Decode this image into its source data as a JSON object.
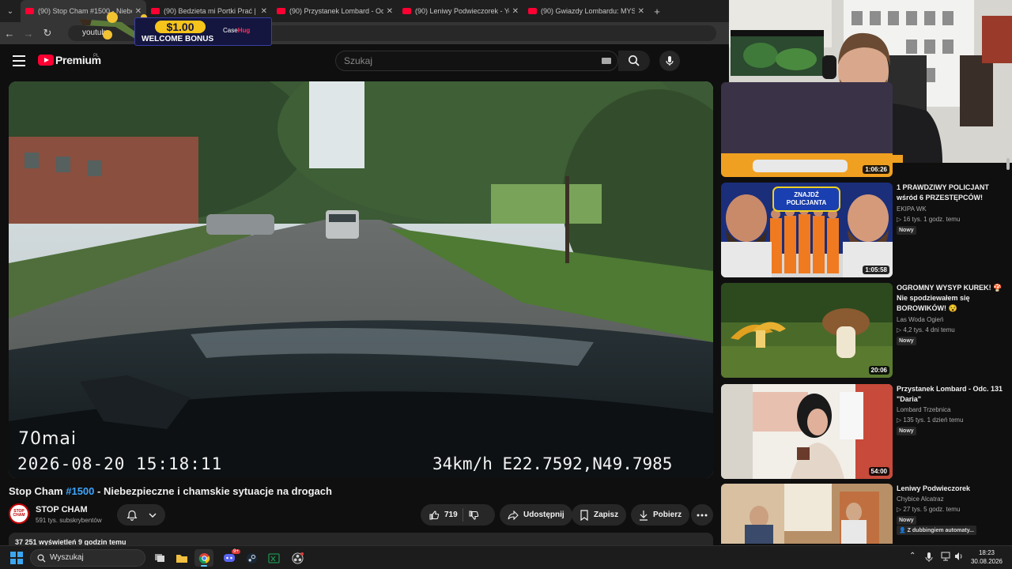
{
  "browser": {
    "tabs": [
      {
        "title": "(90) Stop Cham #1500 - Niebe",
        "active": true
      },
      {
        "title": "(90) Bedzieta mi Portki Prać | Sz",
        "active": false
      },
      {
        "title": "(90) Przystanek Lombard - Odc",
        "active": false
      },
      {
        "title": "(90) Leniwy Podwieczorek - You",
        "active": false
      },
      {
        "title": "(90) Gwiazdy Lombardu: MYSTE",
        "active": false
      }
    ],
    "new_tab_label": "+",
    "url": "youtube"
  },
  "ad": {
    "amount": "$1.00",
    "text": "WELCOME BONUS",
    "brand_a": "Case",
    "brand_b": "Hug"
  },
  "youtube": {
    "logo": "Premium",
    "country_code": "PL",
    "search_placeholder": "Szukaj"
  },
  "player": {
    "osd_brand": "70mai",
    "osd_datetime": "2026-08-20 15:18:11",
    "osd_gps": "34km/h E22.7592,N49.7985"
  },
  "video": {
    "title_prefix": "Stop Cham ",
    "title_tag": "#1500",
    "title_suffix": " - Niebezpieczne i chamskie sytuacje na drogach",
    "channel": "STOP CHAM",
    "channel_avatar_text": "STOP CHAM",
    "subscribers": "591 tys. subskrybentów",
    "likes": "719",
    "share": "Udostępnij",
    "save": "Zapisz",
    "download": "Pobierz",
    "views": "37 251 wyświetleń  9 godzin temu"
  },
  "recommendations": [
    {
      "duration": "1:06:26",
      "title": "",
      "channel": "",
      "meta": "",
      "badge": ""
    },
    {
      "duration": "1:05:58",
      "title": "1 PRAWDZIWY POLICJANT wśród 6 PRZESTĘPCÓW!",
      "channel": "EKIPA WK",
      "meta": "▷ 16 tys.   1 godz. temu",
      "badge": "Nowy",
      "thumb_text": "ZNAJDŹ POLICJANTA"
    },
    {
      "duration": "20:06",
      "title": "OGROMNY WYSYP KUREK! 🍄 Nie spodziewałem się BOROWIKÓW! 😵",
      "channel": "Las Woda Ogień",
      "meta": "▷ 4,2 tys.   4 dni temu",
      "badge": "Nowy"
    },
    {
      "duration": "54:00",
      "title": "Przystanek Lombard - Odc. 131 \"Daria\"",
      "channel": "Lombard Trzebnica",
      "meta": "▷ 135 tys.   1 dzień temu",
      "badge": "Nowy"
    },
    {
      "duration": "",
      "title": "Leniwy Podwieczorek",
      "channel": "Chybice Alcatraz",
      "meta": "▷ 27 tys.   5 godz. temu",
      "badge": "Nowy",
      "badge2": "Z dubbingiem automaty..."
    }
  ],
  "taskbar": {
    "search": "Wyszukaj",
    "discord_badge": "9+",
    "time": "18:23",
    "date": "30.08.2026"
  },
  "colors": {
    "yt_red": "#ff0033",
    "link_blue": "#3ea6ff",
    "bg": "#0f0f0f",
    "pill": "#272727"
  }
}
